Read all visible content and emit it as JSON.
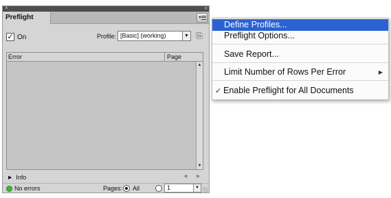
{
  "panel": {
    "close_glyph": "×",
    "collapse_glyph": "«",
    "tab_label": "Preflight",
    "on_label": "On",
    "on_checked": true,
    "profile_label": "Profile:",
    "profile_value": "[Basic] (working)",
    "columns": {
      "error": "Error",
      "page": "Page"
    },
    "info_label": "Info",
    "status_text": "No errors",
    "status_color": "#3fb43f",
    "pages_label": "Pages:",
    "all_label": "All",
    "range_value": "1"
  },
  "menu": {
    "highlight_color": "#2a62d2",
    "items": [
      {
        "label": "Define Profiles..."
      },
      {
        "label": "Preflight Options..."
      },
      {
        "label": "Save Report..."
      },
      {
        "label": "Limit Number of Rows Per Error"
      },
      {
        "label": "Enable Preflight for All Documents",
        "checked": true
      }
    ]
  }
}
